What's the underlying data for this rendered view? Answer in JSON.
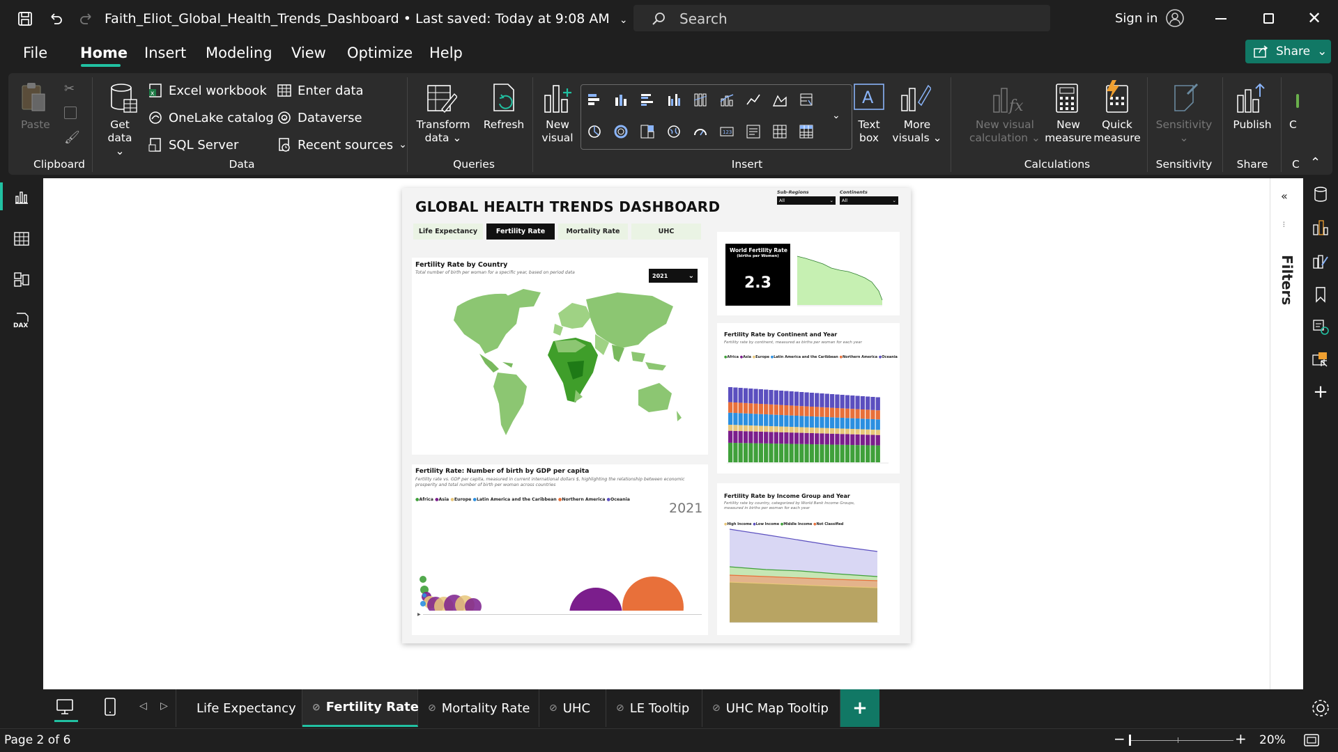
{
  "window": {
    "title": "Faith_Eliot_Global_Health_Trends_Dashboard",
    "saved_status": "Last saved: Today at 9:08 AM",
    "search_placeholder": "Search",
    "sign_in": "Sign in"
  },
  "menu": {
    "items": [
      "File",
      "Home",
      "Insert",
      "Modeling",
      "View",
      "Optimize",
      "Help"
    ],
    "active": "Home",
    "share": "Share"
  },
  "ribbon": {
    "clipboard": {
      "paste": "Paste",
      "group": "Clipboard"
    },
    "data": {
      "get_data": [
        "Get",
        "data"
      ],
      "excel": "Excel workbook",
      "onelake": "OneLake catalog",
      "sql": "SQL Server",
      "enter": "Enter data",
      "dataverse": "Dataverse",
      "recent": "Recent sources",
      "group": "Data"
    },
    "queries": {
      "transform": [
        "Transform",
        "data"
      ],
      "refresh": "Refresh",
      "group": "Queries"
    },
    "insert": {
      "new_visual": [
        "New",
        "visual"
      ],
      "text_box": [
        "Text",
        "box"
      ],
      "more_visuals": [
        "More",
        "visuals"
      ],
      "group": "Insert"
    },
    "calculations": {
      "new_visual_calc": [
        "New visual",
        "calculation"
      ],
      "new_measure": [
        "New",
        "measure"
      ],
      "quick_measure": [
        "Quick",
        "measure"
      ],
      "group": "Calculations"
    },
    "sensitivity": {
      "label": "Sensitivity",
      "group": "Sensitivity"
    },
    "share": {
      "publish": "Publish",
      "group": "Share"
    },
    "overflow_label": "C",
    "overflow_group": "C"
  },
  "filters_label": "Filters",
  "report": {
    "title": "GLOBAL HEALTH TRENDS DASHBOARD",
    "tabs": [
      "Life Expectancy",
      "Fertility Rate",
      "Mortality Rate",
      "UHC"
    ],
    "active_tab": "Fertility Rate",
    "slicers": [
      {
        "label": "Sub-Regions",
        "value": "All"
      },
      {
        "label": "Continents",
        "value": "All"
      }
    ],
    "map": {
      "title": "Fertility Rate by Country",
      "subtitle": "Total number of birth per woman for a specific year, based on period data",
      "year_select": "2021"
    },
    "kpi": {
      "title": "World Fertility Rate",
      "subtitle": "(births per Women)",
      "value": "2.3"
    },
    "continent_chart": {
      "title": "Fertility Rate by Continent and Year",
      "subtitle": "Fertility rate by continent, measured as births per woman for each year",
      "legend": [
        "Africa",
        "Asia",
        "Europe",
        "Latin America and the Caribbean",
        "Northern America",
        "Oceania"
      ]
    },
    "gdp_chart": {
      "title": "Fertility Rate: Number of birth by GDP per capita",
      "subtitle": "Fertility rate vs. GDP per capita, measured in current international dollars $, highlighting the relationship between economic prosperity and total number of birth per woman across countries",
      "legend": [
        "Africa",
        "Asia",
        "Europe",
        "Latin America and the Caribbean",
        "Northern America",
        "Oceania"
      ],
      "year": "2021"
    },
    "income_chart": {
      "title": "Fertility Rate by Income Group and Year",
      "subtitle": "Fertility rate by country, categorized by World Bank Income Groups, measured in births per woman for each year",
      "legend": [
        "High Income",
        "Low Income",
        "Middle Income",
        "Not Classified"
      ]
    }
  },
  "colors": {
    "africa": "#3fa03a",
    "asia": "#7b1e8c",
    "europe": "#e8c77a",
    "latam": "#2b8fe0",
    "namerica": "#e8703a",
    "oceania": "#5b4fbf",
    "accent": "#21c1a2",
    "share": "#117865"
  },
  "page_tabs": [
    "Life Expectancy",
    "Fertility Rate",
    "Mortality Rate",
    "UHC",
    "LE Tooltip",
    "UHC Map Tooltip"
  ],
  "active_page_tab": "Fertility Rate",
  "status": {
    "page": "Page 2 of 6",
    "zoom": "20%"
  }
}
